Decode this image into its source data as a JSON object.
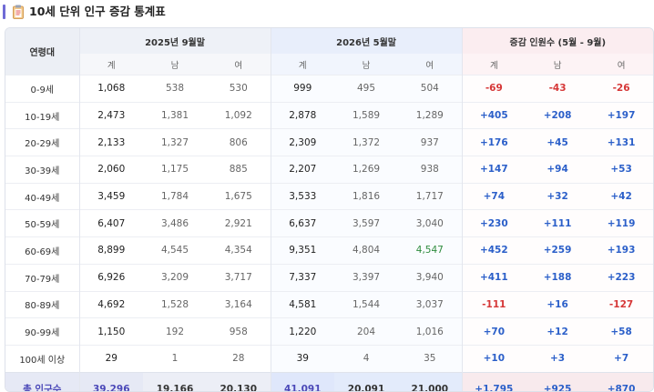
{
  "title": "10세 단위 인구 증감 통계표",
  "header": {
    "age_label": "연령대",
    "group1": "2025년 9월말",
    "group2": "2026년 5월말",
    "group3": "증감 인원수 (5월 - 9월)",
    "sub": [
      "계",
      "남",
      "여",
      "계",
      "남",
      "여",
      "계",
      "남",
      "여"
    ]
  },
  "rows": [
    {
      "age": "0-9세",
      "c": [
        "1,068",
        "538",
        "530",
        "999",
        "495",
        "504",
        "-69",
        "-43",
        "-26"
      ]
    },
    {
      "age": "10-19세",
      "c": [
        "2,473",
        "1,381",
        "1,092",
        "2,878",
        "1,589",
        "1,289",
        "+405",
        "+208",
        "+197"
      ]
    },
    {
      "age": "20-29세",
      "c": [
        "2,133",
        "1,327",
        "806",
        "2,309",
        "1,372",
        "937",
        "+176",
        "+45",
        "+131"
      ]
    },
    {
      "age": "30-39세",
      "c": [
        "2,060",
        "1,175",
        "885",
        "2,207",
        "1,269",
        "938",
        "+147",
        "+94",
        "+53"
      ]
    },
    {
      "age": "40-49세",
      "c": [
        "3,459",
        "1,784",
        "1,675",
        "3,533",
        "1,816",
        "1,717",
        "+74",
        "+32",
        "+42"
      ]
    },
    {
      "age": "50-59세",
      "c": [
        "6,407",
        "3,486",
        "2,921",
        "6,637",
        "3,597",
        "3,040",
        "+230",
        "+111",
        "+119"
      ]
    },
    {
      "age": "60-69세",
      "c": [
        "8,899",
        "4,545",
        "4,354",
        "9,351",
        "4,804",
        "4,547",
        "+452",
        "+259",
        "+193"
      ]
    },
    {
      "age": "70-79세",
      "c": [
        "6,926",
        "3,209",
        "3,717",
        "7,337",
        "3,397",
        "3,940",
        "+411",
        "+188",
        "+223"
      ]
    },
    {
      "age": "80-89세",
      "c": [
        "4,692",
        "1,528",
        "3,164",
        "4,581",
        "1,544",
        "3,037",
        "-111",
        "+16",
        "-127"
      ]
    },
    {
      "age": "90-99세",
      "c": [
        "1,150",
        "192",
        "958",
        "1,220",
        "204",
        "1,016",
        "+70",
        "+12",
        "+58"
      ]
    },
    {
      "age": "100세 이상",
      "c": [
        "29",
        "1",
        "28",
        "39",
        "4",
        "35",
        "+10",
        "+3",
        "+7"
      ]
    }
  ],
  "total": {
    "label": "총 인구수",
    "c": [
      "39,296",
      "19,166",
      "20,130",
      "41,091",
      "20,091",
      "21,000",
      "+1,795",
      "+925",
      "+870"
    ]
  },
  "colors": {
    "accent": "#6f6bd6",
    "positive": "#2b5fc9",
    "negative": "#d63838",
    "green_value": "#2e8b3e"
  },
  "icons": {
    "title_icon": "clipboard-icon"
  }
}
